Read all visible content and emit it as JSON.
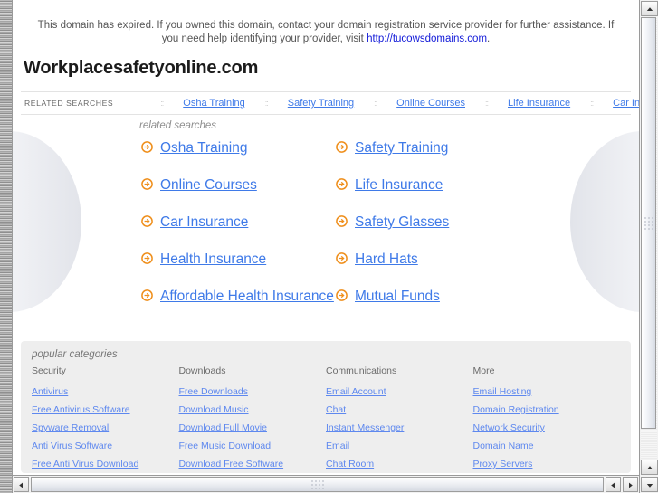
{
  "notice": {
    "text_before_link": "This domain has expired. If you owned this domain, contact your domain registration service provider for further assistance. If you need help identifying your provider, visit ",
    "link_text": "http://tucowsdomains.com",
    "text_after_link": "."
  },
  "domain_title": "Workplacesafetyonline.com",
  "top_bar": {
    "label": "RELATED SEARCHES",
    "separator": "::",
    "links": [
      "Osha Training",
      "Safety Training",
      "Online Courses",
      "Life Insurance",
      "Car Insurance"
    ]
  },
  "hero": {
    "heading": "related searches",
    "links": [
      "Osha Training",
      "Safety Training",
      "Online Courses",
      "Life Insurance",
      "Car Insurance",
      "Safety Glasses",
      "Health Insurance",
      "Hard Hats",
      "Affordable Health Insurance",
      "Mutual Funds"
    ],
    "bullet_icon": "arrow-circle-right-icon"
  },
  "popular": {
    "heading": "popular categories",
    "columns": [
      {
        "title": "Security",
        "links": [
          "Antivirus",
          "Free Antivirus Software",
          "Spyware Removal",
          "Anti Virus Software",
          "Free Anti Virus Download"
        ]
      },
      {
        "title": "Downloads",
        "links": [
          "Free Downloads",
          "Download Music",
          "Download Full Movie",
          "Free Music Download",
          "Download Free Software"
        ]
      },
      {
        "title": "Communications",
        "links": [
          "Email Account",
          "Chat",
          "Instant Messenger",
          "Email",
          "Chat Room"
        ]
      },
      {
        "title": "More",
        "links": [
          "Email Hosting",
          "Domain Registration",
          "Network Security",
          "Domain Name",
          "Proxy Servers"
        ]
      }
    ]
  },
  "colors": {
    "link_blue": "#3f7ae8",
    "notice_link_blue": "#1018d8",
    "arrow_orange": "#ef8f1c",
    "panel_gray": "#eeeeee",
    "body_text": "#555555"
  },
  "scrollbars": {
    "vertical_up_icon": "triangle-up-icon",
    "vertical_down_icon": "triangle-down-icon",
    "horizontal_left_icon": "triangle-left-icon",
    "horizontal_right_icon": "triangle-right-icon"
  }
}
